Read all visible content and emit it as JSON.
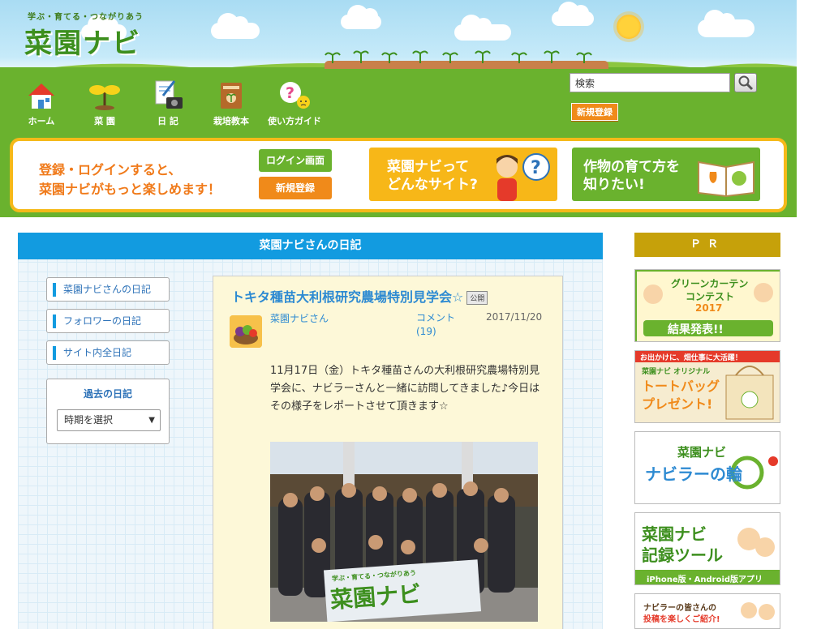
{
  "site": {
    "tagline": "学ぶ・育てる・つながりあう",
    "logo": "菜園ナビ"
  },
  "nav": [
    {
      "label": "ホーム",
      "icon": "house-icon"
    },
    {
      "label": "菜 園",
      "icon": "sprout-icon"
    },
    {
      "label": "日 記",
      "icon": "diary-camera-icon"
    },
    {
      "label": "栽培教本",
      "icon": "textbook-icon"
    },
    {
      "label": "使い方ガイド",
      "icon": "question-icon"
    }
  ],
  "search": {
    "value": "検索",
    "button_icon": "magnifier-icon"
  },
  "header_register": "新規登録",
  "banner": {
    "line1": "登録・ログインすると、",
    "line2": "菜園ナビがもっと楽しめます！",
    "login": "ログイン画面",
    "register": "新規登録",
    "about_line1": "菜園ナビって",
    "about_line2": "どんなサイト?",
    "grow_line1": "作物の育て方を",
    "grow_line2": "知りたい!"
  },
  "main": {
    "title": "菜園ナビさんの日記"
  },
  "sidebar": {
    "items": [
      {
        "label": "菜園ナビさんの日記"
      },
      {
        "label": "フォロワーの日記"
      },
      {
        "label": "サイト内全日記"
      }
    ],
    "past_title": "過去の日記",
    "select_value": "時期を選択"
  },
  "post": {
    "title": "トキタ種苗大利根研究農場特別見学会☆",
    "badge": "公開",
    "author": "菜園ナビ",
    "author_suffix": "さん",
    "comment_label": "コメント",
    "comment_count": "(19)",
    "date": "2017/11/20",
    "body": "11月17日（金）トキタ種苗さんの大利根研究農場特別見学会に、ナビラーさんと一緒に訪問してきました♪今日はその様子をレポートさせて頂きます☆",
    "banner_tag": "学ぶ・育てる・つながりあう",
    "banner_logo": "菜園ナビ"
  },
  "pr": {
    "title": "ＰＲ",
    "ads": [
      {
        "line1": "グリーンカーテン",
        "line2": "コンテスト",
        "line3": "2017",
        "line4": "結果発表!!"
      },
      {
        "top": "お出かけに、畑仕事に大活躍！",
        "sub": "菜園ナビ オリジナル",
        "big1": "トートバッグ",
        "big2": "プレゼント!"
      },
      {
        "line1": "菜園ナビ",
        "line2": "ナビラーの輪"
      },
      {
        "line1": "菜園ナビ",
        "line2": "記録ツール",
        "footer": "iPhone版・Android版アプリ"
      },
      {
        "line1": "ナビラーの皆さんの",
        "line2": "投稿を楽しくご紹介!"
      }
    ]
  },
  "colors": {
    "grass": "#6ab22e",
    "orange": "#f08a1a",
    "blue_title": "#129be0",
    "link": "#2d8ad2",
    "pr_gold": "#c6a10a",
    "banner_border": "#f5b919"
  }
}
